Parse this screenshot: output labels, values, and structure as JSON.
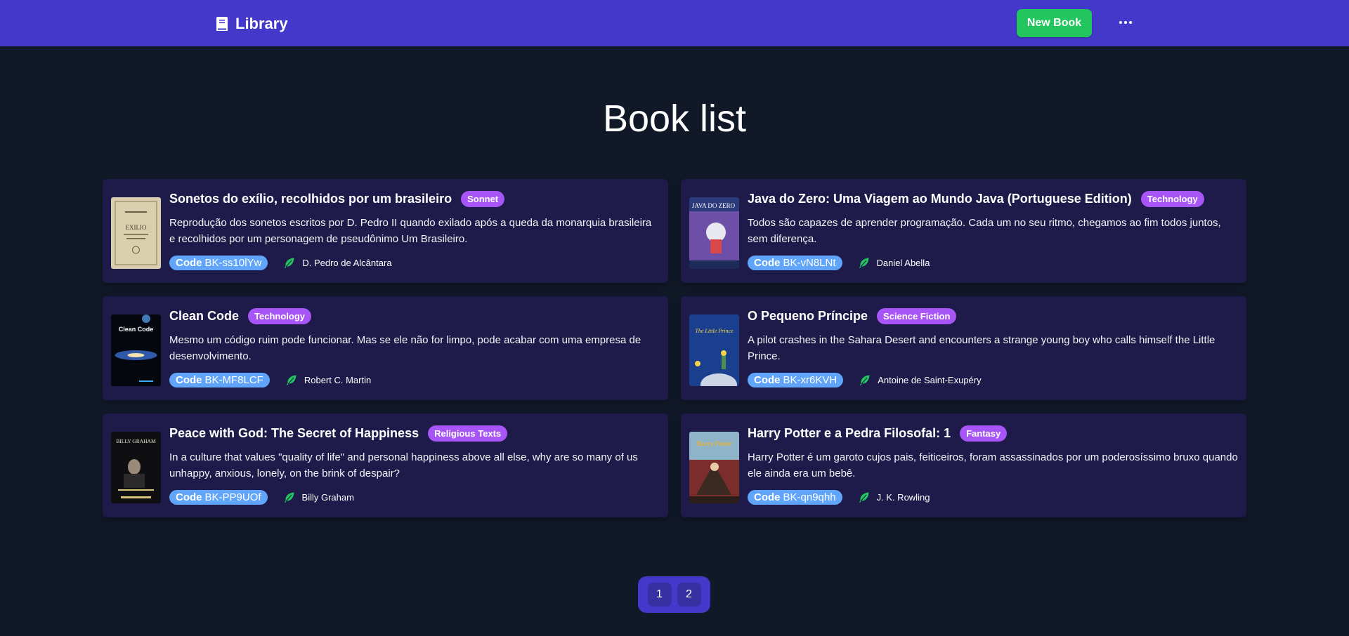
{
  "navbar": {
    "brand": "Library",
    "new_book_label": "New Book",
    "brand_color": "#4338ca",
    "button_color": "#22c55e"
  },
  "page_title": "Book list",
  "books": [
    {
      "title": "Sonetos do exílio, recolhidos por um brasileiro",
      "genre": "Sonnet",
      "description": "Reprodução dos sonetos escritos por D. Pedro II quando exilado após a queda da monarquia brasileira e recolhidos por um personagem de pseudônimo Um Brasileiro.",
      "code_label": "Code",
      "code": "BK-ss10lYw",
      "author": "D. Pedro de Alcântara",
      "cover_text": "EXILIO"
    },
    {
      "title": "Java do Zero: Uma Viagem ao Mundo Java (Portuguese Edition)",
      "genre": "Technology",
      "description": "Todos são capazes de aprender programação. Cada um no seu ritmo, chegamos ao fim todos juntos, sem diferença.",
      "code_label": "Code",
      "code": "BK-vN8LNt",
      "author": "Daniel Abella",
      "cover_text": "JAVA DO ZERO"
    },
    {
      "title": "Clean Code",
      "genre": "Technology",
      "description": "Mesmo um código ruim pode funcionar. Mas se ele não for limpo, pode acabar com uma empresa de desenvolvimento.",
      "code_label": "Code",
      "code": "BK-MF8LCF",
      "author": "Robert C. Martin",
      "cover_text": "Clean Code"
    },
    {
      "title": "O Pequeno Príncipe",
      "genre": "Science Fiction",
      "description": "A pilot crashes in the Sahara Desert and encounters a strange young boy who calls himself the Little Prince.",
      "code_label": "Code",
      "code": "BK-xr6KVH",
      "author": "Antoine de Saint-Exupéry",
      "cover_text": "The Little Prince"
    },
    {
      "title": "Peace with God: The Secret of Happiness",
      "genre": "Religious Texts",
      "description": "In a culture that values \"quality of life\" and personal happiness above all else, why are so many of us unhappy, anxious, lonely, on the brink of despair?",
      "code_label": "Code",
      "code": "BK-PP9UOf",
      "author": "Billy Graham",
      "cover_text": "BILLY GRAHAM"
    },
    {
      "title": "Harry Potter e a Pedra Filosofal: 1",
      "genre": "Fantasy",
      "description": "Harry Potter é um garoto cujos pais, feiticeiros, foram assassinados por um poderosíssimo bruxo quando ele ainda era um bebê.",
      "code_label": "Code",
      "code": "BK-qn9qhh",
      "author": "J. K. Rowling",
      "cover_text": "Harry Potter"
    }
  ],
  "pagination": {
    "pages": [
      "1",
      "2"
    ]
  },
  "colors": {
    "background": "#111827",
    "card": "#1e1b4b",
    "genre_badge": "#a855f7",
    "code_badge": "#60a5fa",
    "feather": "#22c55e"
  },
  "icons": {
    "brand": "book-icon",
    "more": "ellipsis-icon",
    "author": "feather-icon"
  }
}
